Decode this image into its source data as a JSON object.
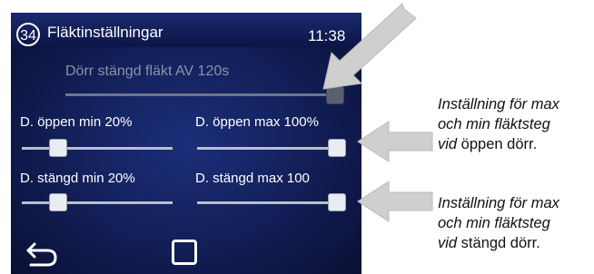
{
  "header": {
    "screen_number": "34",
    "title": "Fläktinställningar",
    "time": "11:38"
  },
  "settings": {
    "door_closed_fan_off": {
      "label": "Dörr stängd fläkt AV  120s",
      "value_fraction": 1.0,
      "enabled": false
    },
    "open_min": {
      "label": "D. öppen min 20%",
      "value_fraction": 0.2
    },
    "open_max": {
      "label": "D. öppen max 100%",
      "value_fraction": 1.0
    },
    "closed_min": {
      "label": "D. stängd min 20%",
      "value_fraction": 0.2
    },
    "closed_max": {
      "label": "D. stängd max 100",
      "value_fraction": 1.0
    }
  },
  "nav": {
    "back_icon": "back-arrow-icon",
    "home_icon": "square-icon"
  },
  "annotations": {
    "open_door": {
      "line1": "Inställning för max",
      "line2": "och min fläktsteg",
      "line3_italic": "vid",
      "line3_rest": " öppen dörr."
    },
    "closed_door": {
      "line1": "Inställning för max",
      "line2": "och min fläktsteg",
      "line3_italic": "vid",
      "line3_rest": " stängd dörr."
    }
  },
  "colors": {
    "screen_bg": "#111c52",
    "text": "#ffffff",
    "dim_text": "#8b92a8",
    "arrow": "#cfcfcf"
  }
}
